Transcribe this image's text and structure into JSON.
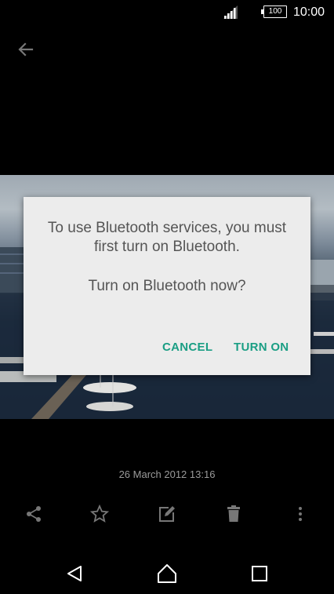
{
  "status_bar": {
    "time": "10:00",
    "battery_level": "100",
    "signal_icon": "signal-icon",
    "battery_icon": "battery-icon"
  },
  "toolbar": {
    "back_icon": "arrow-left-icon"
  },
  "dialog": {
    "message": "To use Bluetooth services, you must first turn on Bluetooth.",
    "question": "Turn on Bluetooth now?",
    "cancel_label": "CANCEL",
    "confirm_label": "TURN ON",
    "accent_color": "#1a9e84"
  },
  "photo": {
    "date": "26 March 2012 13:16"
  },
  "actions": {
    "icons": [
      "share-icon",
      "star-icon",
      "edit-icon",
      "delete-icon",
      "more-icon"
    ]
  },
  "nav": {
    "icons": [
      "back-icon",
      "home-icon",
      "recents-icon"
    ]
  }
}
